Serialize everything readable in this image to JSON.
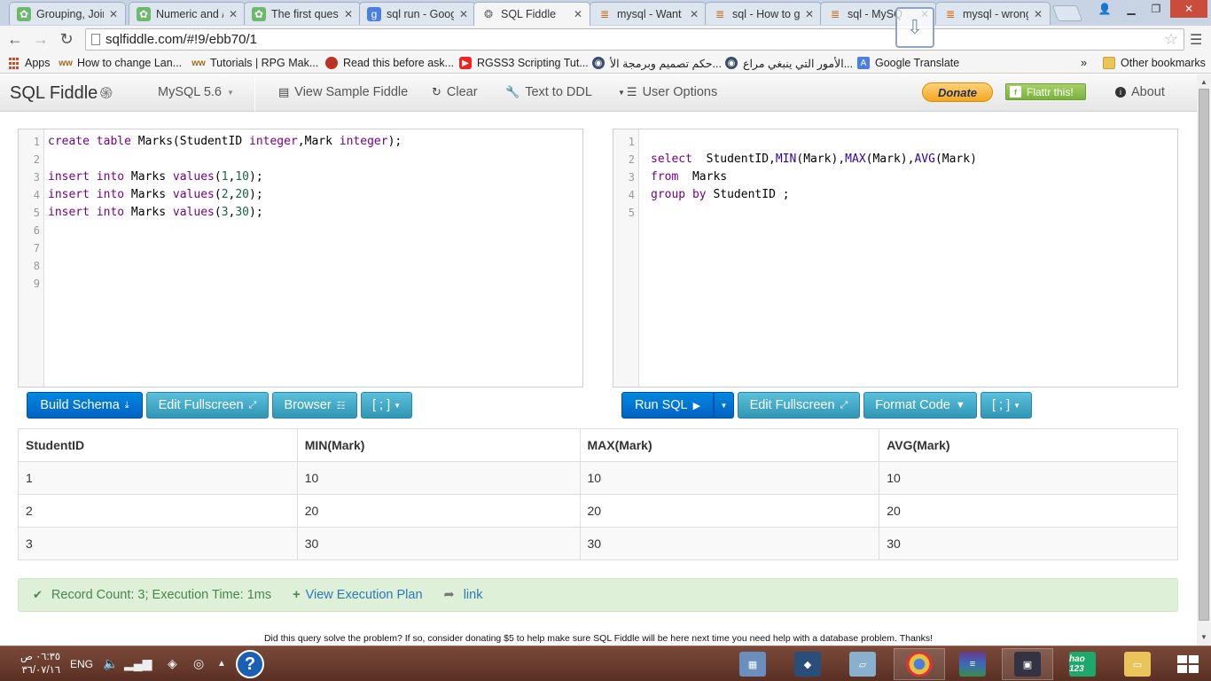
{
  "browser": {
    "tabs": [
      {
        "title": "Grouping, Join",
        "icon": "sqlfiddle-icon"
      },
      {
        "title": "Numeric and /",
        "icon": "sqlfiddle-icon"
      },
      {
        "title": "The first quest",
        "icon": "sqlfiddle-icon"
      },
      {
        "title": "sql run - Goog",
        "icon": "google-icon"
      },
      {
        "title": "SQL Fiddle",
        "icon": "shell-icon"
      },
      {
        "title": "mysql - Want",
        "icon": "stackoverflow-icon"
      },
      {
        "title": "sql - How to g",
        "icon": "stackoverflow-icon"
      },
      {
        "title": "sql - MySQ",
        "icon": "stackoverflow-icon"
      },
      {
        "title": "mysql - wrong",
        "icon": "stackoverflow-icon"
      }
    ],
    "close_glyph": "✕",
    "url": "sqlfiddle.com/#!9/ebb70/1",
    "bookmarks": [
      {
        "label": "Apps"
      },
      {
        "label": "How to change Lan..."
      },
      {
        "label": "Tutorials | RPG Mak..."
      },
      {
        "label": "Read this before ask..."
      },
      {
        "label": "RGSS3 Scripting Tut..."
      },
      {
        "label": "حكم تصميم وبرمجة الأ..."
      },
      {
        "label": "الأمور التي ينبغي مراع..."
      },
      {
        "label": "Google Translate"
      }
    ],
    "more_bookmarks": "»",
    "other_bookmarks": "Other bookmarks"
  },
  "navbar": {
    "brand": "SQL Fiddle",
    "db_version": "MySQL 5.6",
    "view_sample": "View Sample Fiddle",
    "clear": "Clear",
    "text_to_ddl": "Text to DDL",
    "user_options": "User Options",
    "donate": "Donate",
    "flattr": "Flattr this!",
    "about": "About"
  },
  "schema_editor": {
    "line_numbers": [
      "1",
      "2",
      "3",
      "4",
      "5",
      "6",
      "7",
      "8",
      "9"
    ],
    "code": {
      "l1": {
        "a": "create",
        "b": " ",
        "c": "table",
        "d": " Marks(StudentID ",
        "e": "integer",
        "f": ",Mark ",
        "g": "integer",
        "h": ");"
      },
      "l3": {
        "a": "insert",
        "b": " ",
        "c": "into",
        "d": " Marks ",
        "e": "values",
        "f": "(",
        "g": "1",
        "h": ",",
        "i": "10",
        "j": ");"
      },
      "l4": {
        "a": "insert",
        "b": " ",
        "c": "into",
        "d": " Marks ",
        "e": "values",
        "f": "(",
        "g": "2",
        "h": ",",
        "i": "20",
        "j": ");"
      },
      "l5": {
        "a": "insert",
        "b": " ",
        "c": "into",
        "d": " Marks ",
        "e": "values",
        "f": "(",
        "g": "3",
        "h": ",",
        "i": "30",
        "j": ");"
      }
    }
  },
  "query_editor": {
    "line_numbers": [
      "1",
      "2",
      "3",
      "4",
      "5"
    ],
    "code": {
      "l2": {
        "a": "select",
        "b": "  StudentID,",
        "c": "MIN",
        "d": "(Mark),",
        "e": "MAX",
        "f": "(Mark),",
        "g": "AVG",
        "h": "(Mark)"
      },
      "l3": {
        "a": "from",
        "b": "  Marks"
      },
      "l4": {
        "a": "group",
        "b": " ",
        "c": "by",
        "d": " StudentID ;"
      }
    }
  },
  "schema_buttons": {
    "build": "Build Schema",
    "fullscreen": "Edit Fullscreen",
    "browser": "Browser",
    "terminator": "[ ; ]"
  },
  "query_buttons": {
    "run": "Run SQL",
    "fullscreen": "Edit Fullscreen",
    "format": "Format Code",
    "terminator": "[ ; ]"
  },
  "results": {
    "columns": [
      "StudentID",
      "MIN(Mark)",
      "MAX(Mark)",
      "AVG(Mark)"
    ],
    "rows": [
      [
        "1",
        "10",
        "10",
        "10"
      ],
      [
        "2",
        "20",
        "20",
        "20"
      ],
      [
        "3",
        "30",
        "30",
        "30"
      ]
    ]
  },
  "status": {
    "record_info": "Record Count: 3; Execution Time: 1ms",
    "execution_plan": "View Execution Plan",
    "link": "link"
  },
  "footnote": "Did this query solve the problem? If so, consider donating $5 to help make sure SQL Fiddle will be here next time you need help with a database problem. Thanks!",
  "taskbar": {
    "time": "٠٦:٣٥ ص",
    "date": "٣٦/٠٧/١٦",
    "lang": "ENG",
    "help": "?",
    "hao_label": "hao 123"
  }
}
